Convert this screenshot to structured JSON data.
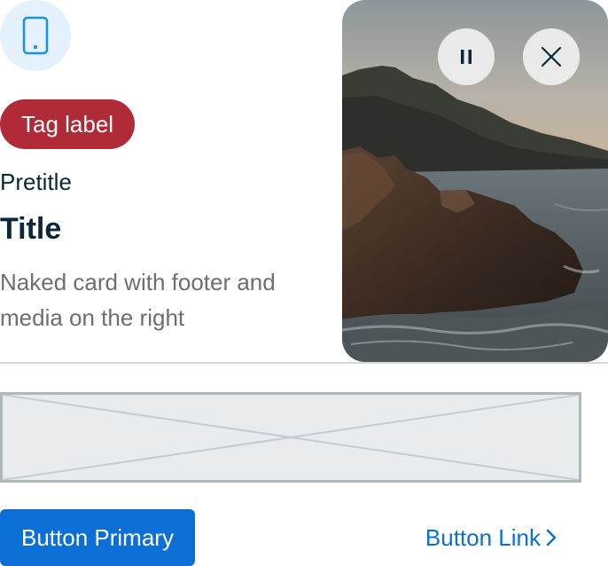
{
  "card": {
    "icon": "mobile-phone-icon",
    "tag_label": "Tag label",
    "pretitle": "Pretitle",
    "title": "Title",
    "description": "Naked card with footer and media on the right"
  },
  "media": {
    "image": "coastal-cliffs-photo",
    "controls": [
      "pause-icon",
      "close-icon"
    ]
  },
  "footer": {
    "placeholder": "slot-placeholder",
    "primary_button": "Button Primary",
    "link_button": "Button Link",
    "link_icon": "chevron-right-icon"
  },
  "colors": {
    "tag": "#b12a37",
    "primary": "#0b6fd6",
    "text": "#0b2739",
    "muted": "#6b6f72",
    "icon_bg": "#e3f2fd"
  }
}
